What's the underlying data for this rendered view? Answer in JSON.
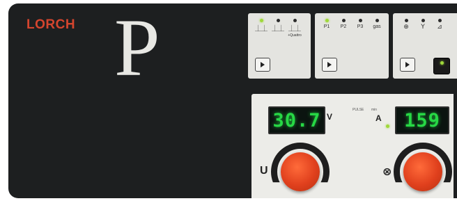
{
  "brand": {
    "name": "LORCH"
  },
  "mode_letter": "P",
  "module_mode": {
    "indicators": [
      {
        "led": "on",
        "symbol": "⏊⏊"
      },
      {
        "led": "off",
        "symbol": "⏊⏊"
      },
      {
        "led": "off",
        "symbol": "⏊⏊",
        "sub": "+Quattro"
      }
    ]
  },
  "module_program": {
    "indicators": [
      {
        "led": "on",
        "label": "P1"
      },
      {
        "led": "off",
        "label": "P2"
      },
      {
        "led": "off",
        "label": "P3"
      },
      {
        "led": "off",
        "label": "gas"
      }
    ]
  },
  "module_function": {
    "indicators": [
      {
        "led": "off",
        "symbol": "⊕"
      },
      {
        "led": "off",
        "symbol": "Y"
      },
      {
        "led": "off",
        "symbol": "⊿"
      }
    ]
  },
  "voltage_display": {
    "value": "30.7",
    "unit": "V"
  },
  "current_display": {
    "value": "159",
    "unit": "A"
  },
  "center_labels": {
    "a": "PULSE",
    "b": "min"
  },
  "knobs": {
    "left_label": "U",
    "right_label": "⊗"
  },
  "colors": {
    "panel": "#1d1f20",
    "brand": "#d4452e",
    "led_on": "#9fd83a",
    "display_text": "#27d845",
    "knob": "#e0401d"
  }
}
